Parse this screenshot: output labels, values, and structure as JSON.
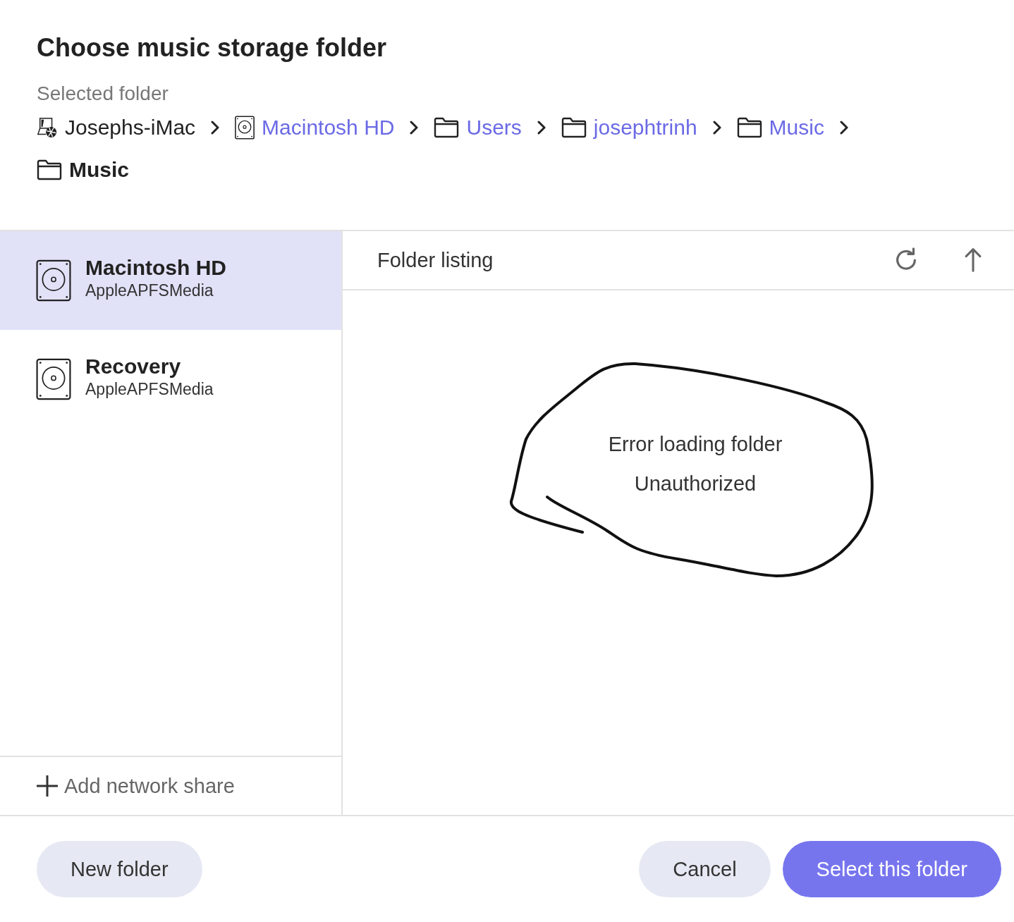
{
  "dialog": {
    "title": "Choose music storage folder",
    "selected_label": "Selected folder"
  },
  "breadcrumb": [
    {
      "kind": "computer",
      "label": "Josephs-iMac",
      "link": false,
      "current": false
    },
    {
      "kind": "drive",
      "label": "Macintosh HD",
      "link": true,
      "current": false
    },
    {
      "kind": "folder",
      "label": "Users",
      "link": true,
      "current": false
    },
    {
      "kind": "folder",
      "label": "josephtrinh",
      "link": true,
      "current": false
    },
    {
      "kind": "folder",
      "label": "Music",
      "link": true,
      "current": false
    },
    {
      "kind": "folder",
      "label": "Music",
      "link": false,
      "current": true
    }
  ],
  "sidebar": {
    "items": [
      {
        "name": "Macintosh HD",
        "subtitle": "AppleAPFSMedia",
        "selected": true
      },
      {
        "name": "Recovery",
        "subtitle": "AppleAPFSMedia",
        "selected": false
      }
    ],
    "add_share": "Add network share"
  },
  "listing": {
    "title": "Folder listing",
    "error_title": "Error loading folder",
    "error_detail": "Unauthorized"
  },
  "buttons": [
    {
      "label": "New folder",
      "kind": "secondary"
    },
    {
      "label": "Cancel",
      "kind": "secondary"
    },
    {
      "label": "Select this folder",
      "kind": "primary"
    }
  ]
}
